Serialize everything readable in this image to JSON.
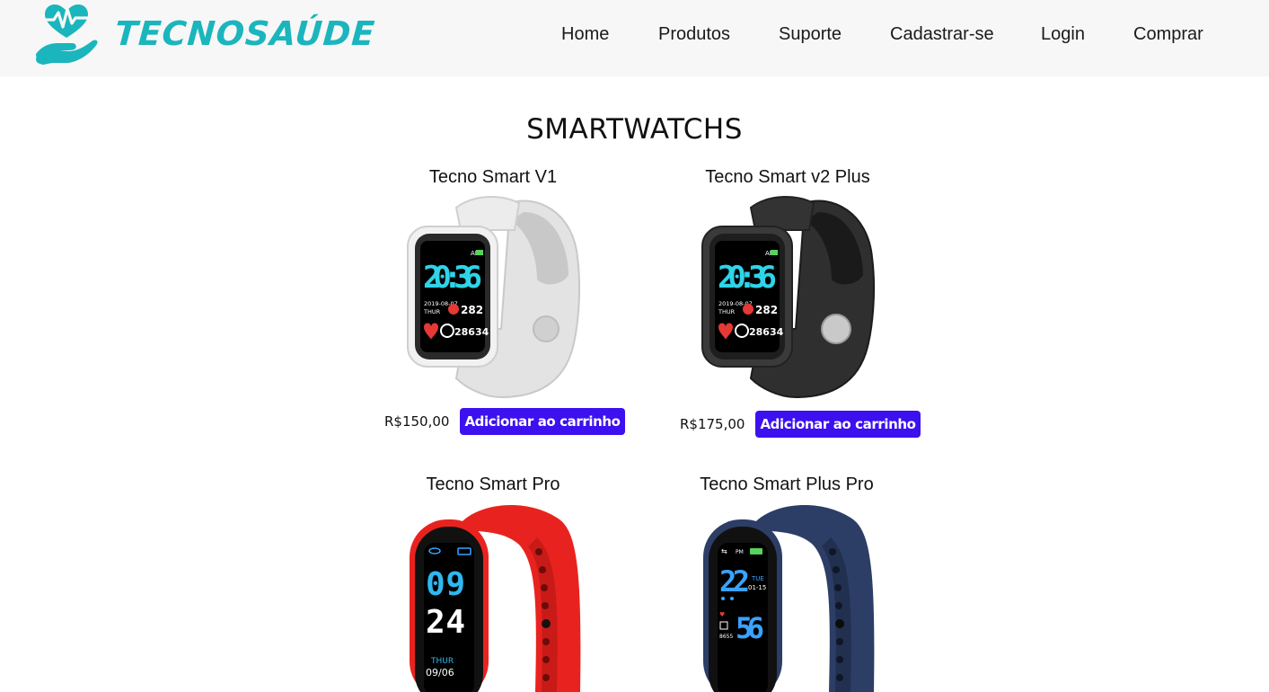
{
  "brand": {
    "name": "TECNOSAÚDE",
    "logo_icon": "heart-hand-icon",
    "color": "#1bb5bd"
  },
  "nav": {
    "items": [
      {
        "label": "Home"
      },
      {
        "label": "Produtos"
      },
      {
        "label": "Suporte"
      },
      {
        "label": "Cadastrar-se"
      },
      {
        "label": "Login"
      },
      {
        "label": "Comprar"
      }
    ]
  },
  "main": {
    "title": "SMARTWATCHS",
    "products": [
      {
        "name": "Tecno Smart V1",
        "price": "R$150,00",
        "button": "Adicionar ao carrinho",
        "color": "#e8e8e8",
        "screen": {
          "time": "20:36",
          "date": "2019-08-07",
          "day": "THUR",
          "value1": "282",
          "value2": "28634",
          "period": "AM"
        }
      },
      {
        "name": "Tecno Smart v2 Plus",
        "price": "R$175,00",
        "button": "Adicionar ao carrinho",
        "color": "#2b2b2b",
        "screen": {
          "time": "20:36",
          "date": "2019-08-07",
          "day": "THUR",
          "value1": "282",
          "value2": "28634",
          "period": "AM"
        }
      },
      {
        "name": "Tecno Smart Pro",
        "price": "",
        "button": "",
        "color": "#e8231f",
        "screen": {
          "hour": "09",
          "minute": "24",
          "day": "THUR",
          "date": "09/06"
        }
      },
      {
        "name": "Tecno Smart Plus Pro",
        "price": "",
        "button": "",
        "color": "#2c3d66",
        "screen": {
          "hour": "22",
          "minute": "56",
          "day": "TUE",
          "date": "01-15",
          "period": "PM",
          "value": "8655"
        }
      }
    ],
    "button_color": "#3d10f0"
  }
}
